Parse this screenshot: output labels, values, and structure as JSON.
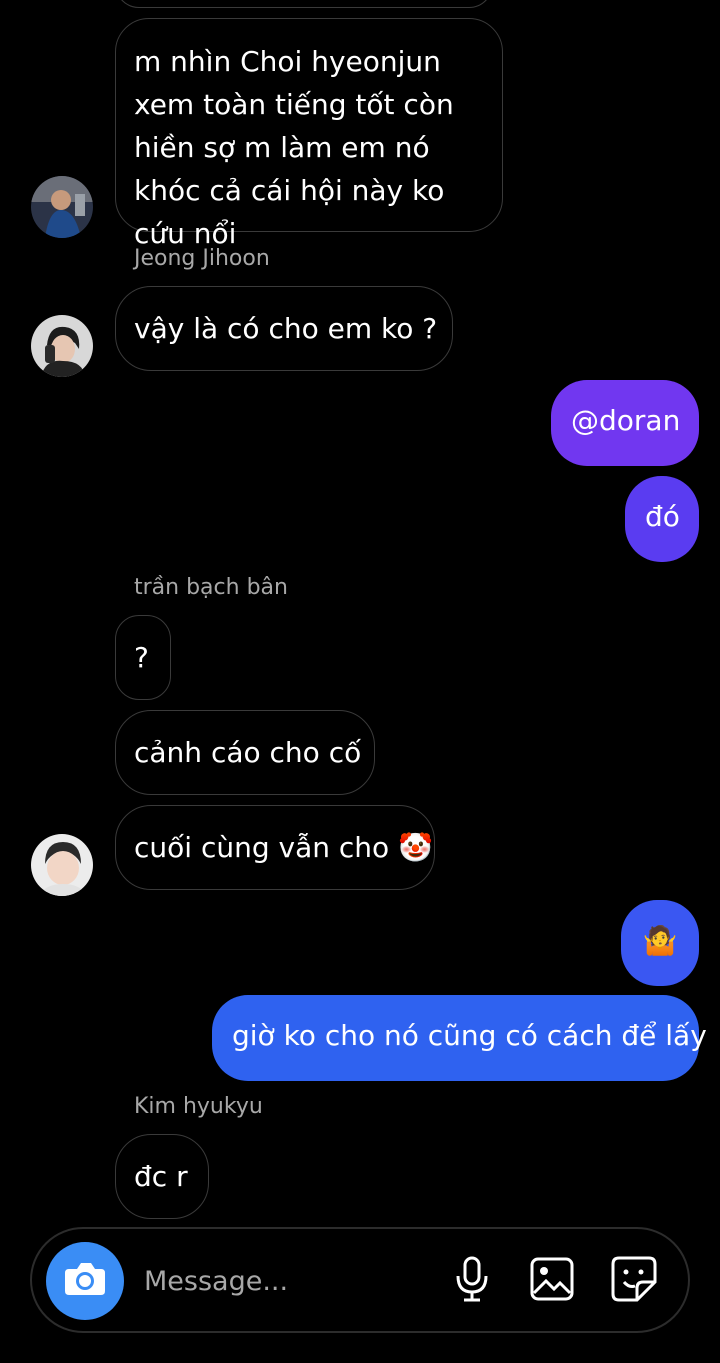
{
  "messages": {
    "m1": {
      "text": "m nhìn Choi hyeonjun xem toàn tiếng tốt còn hiền sợ m làm em nó khóc cả cái hội này ko cứu nổi"
    },
    "m2": {
      "sender": "Jeong Jihoon",
      "text": "vậy là có cho em ko ?"
    },
    "m3": {
      "text": "@doran"
    },
    "m4": {
      "text": "đó"
    },
    "m5": {
      "sender": "trần bạch bân",
      "text": "?"
    },
    "m6": {
      "text": "cảnh cáo cho cố"
    },
    "m7": {
      "text": "cuối cùng vẫn cho 🤡"
    },
    "m8": {
      "text": "🤷"
    },
    "m9": {
      "text": "giờ ko cho nó cũng có cách để lấy"
    },
    "m10": {
      "sender": "Kim hyukyu",
      "text": "đc r"
    }
  },
  "composer": {
    "placeholder": "Message...",
    "icons": [
      "camera-icon",
      "microphone-icon",
      "image-icon",
      "sticker-icon"
    ]
  },
  "colors": {
    "outgoing_purple": "#7137f0",
    "outgoing_mid": "#5a3cf1",
    "outgoing_blue": "#2f62f0",
    "camera_button": "#3a8df5",
    "incoming_border": "#3a3a3a",
    "sender_name": "#a8a8a8"
  }
}
